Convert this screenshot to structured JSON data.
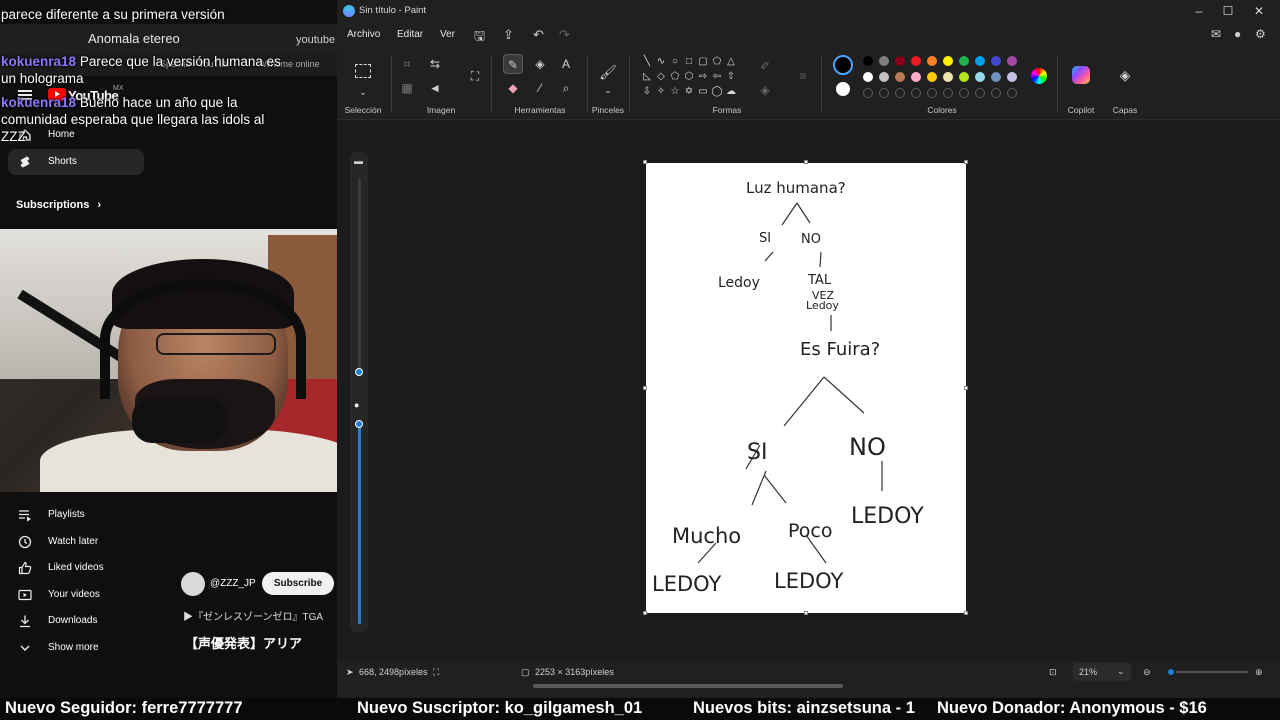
{
  "youtube": {
    "tab_title": "Anomala etereo",
    "address_fragment": "youtube",
    "bookmarks": [
      "Sparxie - YouTub",
      "Whome online"
    ],
    "logo_text": "YouTube",
    "logo_region": "MX",
    "nav_top": [
      {
        "label": "Home",
        "icon": "home-icon"
      },
      {
        "label": "Shorts",
        "icon": "shorts-icon"
      }
    ],
    "subscriptions_label": "Subscriptions",
    "nav_you": [
      {
        "label": "Playlists",
        "icon": "playlists-icon"
      },
      {
        "label": "Watch later",
        "icon": "clock-icon"
      },
      {
        "label": "Liked videos",
        "icon": "thumb-up-icon"
      },
      {
        "label": "Your videos",
        "icon": "video-icon"
      },
      {
        "label": "Downloads",
        "icon": "download-icon"
      },
      {
        "label": "Show more",
        "icon": "chevron-down-icon"
      }
    ],
    "channel_name": "@ZZZ_JP",
    "subscribe_label": "Subscribe",
    "playlist_line": "▶『ゼンレスゾーンゼロ』TGA",
    "video_title": "【声優発表】アリア"
  },
  "chat": [
    {
      "user": "",
      "text": "parece diferente a su primera versión"
    },
    {
      "user": "kokuenra18",
      "text": "Parece que la versión humana es"
    },
    {
      "user": "",
      "text": "un holograma"
    },
    {
      "user": "kokuenra18",
      "text": "Bueno hace un año que la"
    },
    {
      "user": "",
      "text": "comunidad esperaba que llegara las idols al"
    },
    {
      "user": "",
      "text": "ZZZ"
    }
  ],
  "paint": {
    "title": "Sin título - Paint",
    "menu": [
      "Archivo",
      "Editar",
      "Ver"
    ],
    "groups": [
      "Selección",
      "Imagen",
      "Herramientas",
      "Pinceles",
      "Formas",
      "Colores",
      "Copilot",
      "Capas"
    ],
    "status": {
      "cursor": "668, 2498píxeles",
      "size": "2253 × 3163píxeles",
      "zoom": "21%"
    },
    "colors": {
      "primary": "#000000",
      "secondary": "#ffffff",
      "palette_row1": [
        "#000000",
        "#7f7f7f",
        "#880015",
        "#ed1c24",
        "#ff7f27",
        "#fff200",
        "#22b14c",
        "#00a2e8",
        "#3f48cc",
        "#a349a4"
      ],
      "palette_row2": [
        "#ffffff",
        "#c3c3c3",
        "#b97a57",
        "#ffaec9",
        "#ffc90e",
        "#efe4b0",
        "#b5e61d",
        "#99d9ea",
        "#7092be",
        "#c8bfe7"
      ]
    }
  },
  "drawing": {
    "root": "Luz humana?",
    "si": "SI",
    "no": "NO",
    "le_doy": "Ledoy",
    "tal_vez": "TAL",
    "tal_vez2": "VEZ",
    "tal_vez3": "Ledoy",
    "es_fuira": "Es Fuira?",
    "si2": "SI",
    "no2": "NO",
    "ledoy_no": "LEDOY",
    "mucho": "Mucho",
    "poco": "Poco",
    "ledoy_a": "LEDOY",
    "ledoy_b": "LEDOY"
  },
  "ticker": {
    "follower": "Nuevo Seguidor: ferre7777777",
    "subscriber": "Nuevo Suscriptor: ko_gilgamesh_01",
    "bits": "Nuevos bits: ainzsetsuna - 1",
    "donor": "Nuevo Donador: Anonymous - $16"
  }
}
